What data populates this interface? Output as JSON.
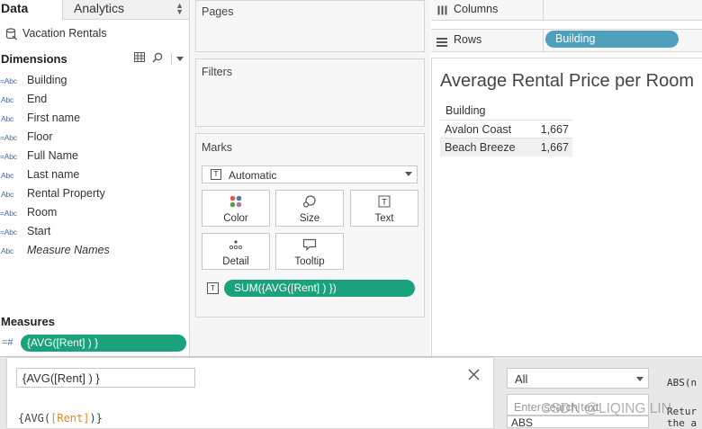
{
  "data_pane": {
    "tab_data": "Data",
    "tab_analytics": "Analytics",
    "datasource": "Vacation Rentals",
    "dimensions_title": "Dimensions",
    "dimension_type": "Abc",
    "dimensions": [
      {
        "label": "Building",
        "prefix": "="
      },
      {
        "label": "End",
        "prefix": ""
      },
      {
        "label": "First name",
        "prefix": ""
      },
      {
        "label": "Floor",
        "prefix": "="
      },
      {
        "label": "Full Name",
        "prefix": "="
      },
      {
        "label": "Last name",
        "prefix": ""
      },
      {
        "label": "Rental Property",
        "prefix": ""
      },
      {
        "label": "Room",
        "prefix": "="
      },
      {
        "label": "Start",
        "prefix": "="
      },
      {
        "label": "Measure Names",
        "prefix": ""
      }
    ],
    "measures_title": "Measures",
    "measure_type": "=#",
    "measure_pill": "{AVG([Rent] ) }"
  },
  "shelves": {
    "pages_title": "Pages",
    "filters_title": "Filters",
    "marks_title": "Marks",
    "mark_type": "Automatic",
    "mark_buttons": [
      "Color",
      "Size",
      "Text",
      "Detail",
      "Tooltip"
    ],
    "marks_pill": "SUM({AVG([Rent] ) })"
  },
  "view": {
    "columns_label": "Columns",
    "rows_label": "Rows",
    "rows_pill": "Building",
    "title": "Average Rental Price per Room",
    "row_header": "Building",
    "rows": [
      {
        "building": "Avalon Coast",
        "value": "1,667"
      },
      {
        "building": "Beach Breeze",
        "value": "1,667"
      }
    ]
  },
  "calc_editor": {
    "name": "{AVG([Rent] ) }",
    "formula_open": "{AVG(",
    "formula_field": "[Rent]",
    "formula_close": ")}",
    "function_filter": "All",
    "search_placeholder": "Enter search text",
    "first_function": "ABS",
    "description_title": "ABS(n",
    "description_text": "Retur\nthe a"
  },
  "watermark": "CSDN @LIQING LIN"
}
